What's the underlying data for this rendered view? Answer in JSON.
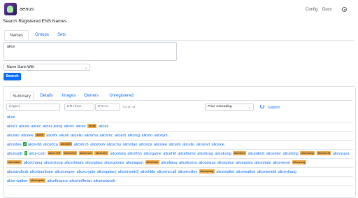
{
  "app": {
    "brand": "aenus",
    "subtitle": "Search Registered ENS Names"
  },
  "nav": {
    "config": "Config",
    "docs": "Docs"
  },
  "top_tabs": [
    "Names",
    "Groups",
    "Sets"
  ],
  "search": {
    "value": "alice",
    "mode": "Name Starts With",
    "button": "Search"
  },
  "result_tabs": [
    "Summary",
    "Details",
    "Images",
    "Owners",
    "Unregistered"
  ],
  "filters": {
    "regex_placeholder": "(regex)",
    "eth_from": "ETH from",
    "eth_to": "ETH to",
    "count": "731 of 731",
    "sort": "Price Ascending",
    "export": "Export"
  },
  "rows": [
    [
      {
        "t": "n",
        "v": "alice"
      }
    ],
    [
      {
        "t": "n",
        "v": "alice1"
      },
      {
        "t": "n",
        "v": "alicea"
      },
      {
        "t": "n",
        "v": "alicec"
      },
      {
        "t": "n",
        "v": "alicei"
      },
      {
        "t": "n",
        "v": "alicej"
      },
      {
        "t": "n",
        "v": "alices"
      },
      {
        "t": "n",
        "v": "alicex"
      },
      {
        "t": "b",
        "v": "alicey"
      },
      {
        "t": "n",
        "v": "alicez"
      }
    ],
    [
      {
        "t": "n",
        "v": "alicean"
      },
      {
        "t": "n",
        "v": "aliceee"
      },
      {
        "t": "b",
        "v": "alicefi"
      },
      {
        "t": "n",
        "v": "alicefx"
      },
      {
        "t": "n",
        "v": "aliceli"
      },
      {
        "t": "n",
        "v": "aliceliu"
      },
      {
        "t": "n",
        "v": "alicema"
      },
      {
        "t": "n",
        "v": "alicemc"
      },
      {
        "t": "n",
        "v": "alicent"
      },
      {
        "t": "n",
        "v": "alicesg"
      },
      {
        "t": "n",
        "v": "alicexi"
      },
      {
        "t": "n",
        "v": "aliceym"
      }
    ],
    [
      {
        "t": "n",
        "v": "alicedee"
      },
      {
        "t": "c",
        "v": "2"
      },
      {
        "t": "n",
        "v": "alice-bb"
      },
      {
        "t": "n",
        "v": "alice01a"
      },
      {
        "t": "b",
        "v": "alice555"
      },
      {
        "t": "n",
        "v": "alice616"
      },
      {
        "t": "n",
        "v": "alicebob"
      },
      {
        "t": "n",
        "v": "alicechu"
      },
      {
        "t": "n",
        "v": "alicedao"
      },
      {
        "t": "n",
        "v": "aliceice"
      },
      {
        "t": "n",
        "v": "aliceiee"
      },
      {
        "t": "n",
        "v": "aliceiln"
      },
      {
        "t": "n",
        "v": "aliceliu"
      },
      {
        "t": "n",
        "v": "alicenet"
      },
      {
        "t": "n",
        "v": "alicexie"
      }
    ],
    [
      {
        "t": "n",
        "v": "aliceusdt"
      },
      {
        "t": "c",
        "v": "8"
      },
      {
        "t": "n",
        "v": "alice-com"
      },
      {
        "t": "b",
        "v": "alice1723"
      },
      {
        "t": "b",
        "v": "alicebank"
      },
      {
        "t": "b",
        "v": "alicechan"
      },
      {
        "t": "b",
        "v": "alicechen"
      },
      {
        "t": "n",
        "v": "alicedata"
      },
      {
        "t": "n",
        "v": "alicefinn"
      },
      {
        "t": "n",
        "v": "alicegame"
      },
      {
        "t": "n",
        "v": "alicehill"
      },
      {
        "t": "n",
        "v": "alicehome"
      },
      {
        "t": "n",
        "v": "alicekrag"
      },
      {
        "t": "n",
        "v": "alicekong"
      },
      {
        "t": "b",
        "v": "alicelove"
      },
      {
        "t": "n",
        "v": "alicenbob"
      },
      {
        "t": "n",
        "v": "alicenter"
      },
      {
        "t": "n",
        "v": "alicetong"
      },
      {
        "t": "b",
        "v": "alicewang"
      },
      {
        "t": "b",
        "v": "aliceworld"
      },
      {
        "t": "n",
        "v": "aliceyuyu"
      }
    ],
    [
      {
        "t": "b",
        "v": "alicebaker"
      },
      {
        "t": "n",
        "v": "alicechang"
      },
      {
        "t": "n",
        "v": "alicechung"
      },
      {
        "t": "n",
        "v": "alicedream"
      },
      {
        "t": "n",
        "v": "aliceglass"
      },
      {
        "t": "n",
        "v": "alicegomes"
      },
      {
        "t": "n",
        "v": "alicejapan"
      },
      {
        "t": "b",
        "v": "alicelewis"
      },
      {
        "t": "n",
        "v": "aliceliang"
      },
      {
        "t": "n",
        "v": "alicekoma"
      },
      {
        "t": "n",
        "v": "alicepizza"
      },
      {
        "t": "n",
        "v": "aliceprice"
      },
      {
        "t": "n",
        "v": "alicespies"
      },
      {
        "t": "n",
        "v": "alicestats"
      },
      {
        "t": "n",
        "v": "aliceverse"
      },
      {
        "t": "b",
        "v": "aliceyang"
      }
    ],
    [
      {
        "t": "n",
        "v": "aliceandbob"
      },
      {
        "t": "n",
        "v": "alicebambam"
      },
      {
        "t": "n",
        "v": "alicecooper"
      },
      {
        "t": "n",
        "v": "alicecrypto"
      },
      {
        "t": "n",
        "v": "alicegalaxy"
      },
      {
        "t": "n",
        "v": "aliceinweb3"
      },
      {
        "t": "n",
        "v": "alicelittle"
      },
      {
        "t": "n",
        "v": "alicemccall"
      },
      {
        "t": "n",
        "v": "alicemolloy"
      },
      {
        "t": "b",
        "v": "alicespring"
      },
      {
        "t": "n",
        "v": "alicewallet"
      },
      {
        "t": "n",
        "v": "alicewalton"
      },
      {
        "t": "n",
        "v": "aliceweidel"
      },
      {
        "t": "n",
        "v": "aliceyliang"
      }
    ],
    [
      {
        "t": "n",
        "v": "alice-walton"
      },
      {
        "t": "b",
        "v": "alicecapital"
      },
      {
        "t": "n",
        "v": "alicefinance"
      },
      {
        "t": "n",
        "v": "alicehoffman"
      },
      {
        "t": "n",
        "v": "alicenetwork"
      }
    ]
  ]
}
